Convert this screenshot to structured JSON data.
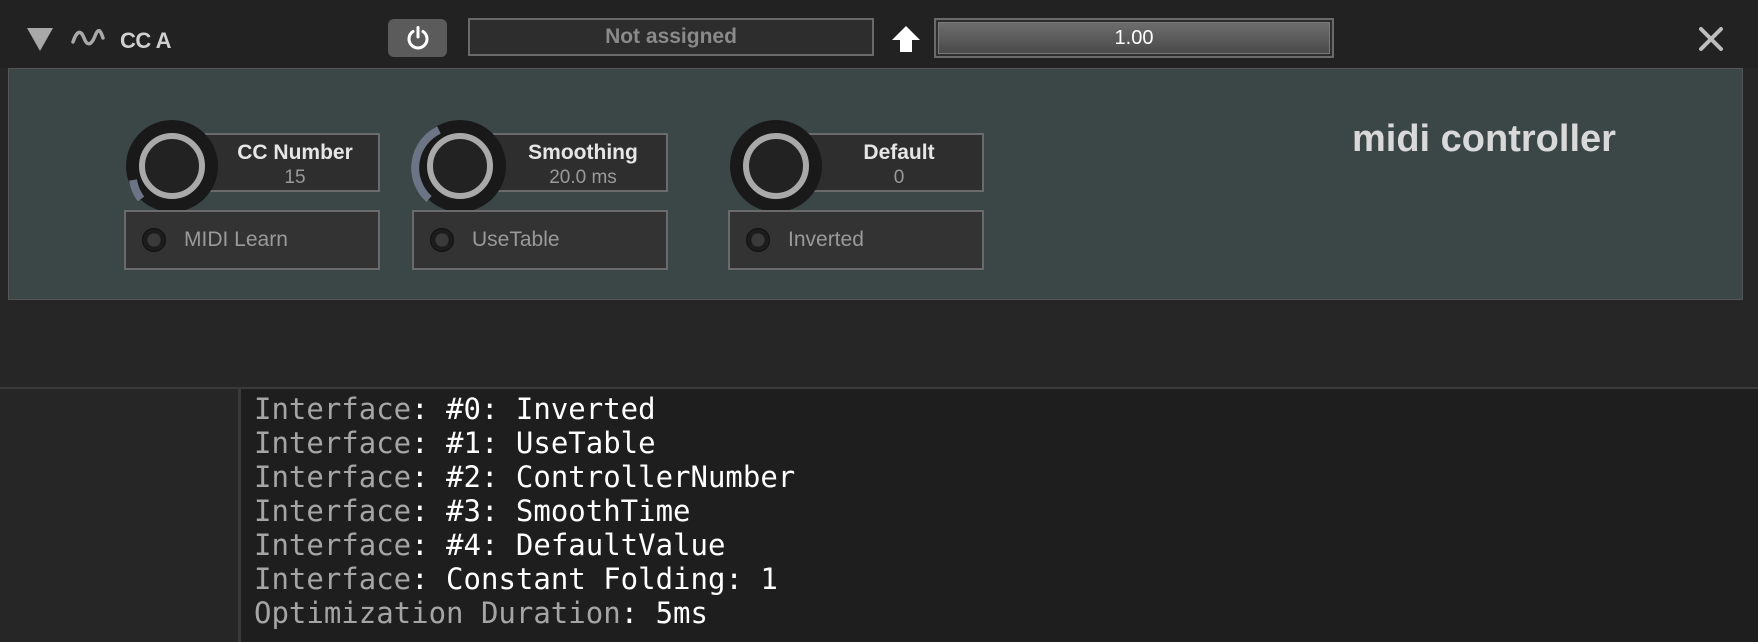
{
  "header": {
    "module_name": "CC A",
    "assignment": "Not assigned",
    "value": "1.00",
    "value_fraction": 1.0
  },
  "panel": {
    "title": "midi controller",
    "knobs": [
      {
        "label": "CC Number",
        "value": "15"
      },
      {
        "label": "Smoothing",
        "value": "20.0 ms"
      },
      {
        "label": "Default",
        "value": "0"
      }
    ],
    "toggles": [
      {
        "label": "MIDI Learn"
      },
      {
        "label": "UseTable"
      },
      {
        "label": "Inverted"
      }
    ]
  },
  "console": {
    "lines": [
      {
        "key": "Interface",
        "text": ": #0: Inverted"
      },
      {
        "key": "Interface",
        "text": ": #1: UseTable"
      },
      {
        "key": "Interface",
        "text": ": #2: ControllerNumber"
      },
      {
        "key": "Interface",
        "text": ": #3: SmoothTime"
      },
      {
        "key": "Interface",
        "text": ": #4: DefaultValue"
      },
      {
        "key": "Interface",
        "text": ": Constant Folding: 1"
      },
      {
        "key": "Optimization Duration",
        "text": ": 5ms"
      }
    ]
  },
  "icons": {
    "collapse": "triangle-down-icon",
    "module_type": "wave-icon",
    "power": "power-icon",
    "arrow": "arrow-up-icon",
    "close": "close-icon"
  },
  "colors": {
    "panel_bg": "#3b4647",
    "header_bg": "#222222",
    "console_bg": "#1e1e1e",
    "knob_arc": "#6c7585"
  }
}
